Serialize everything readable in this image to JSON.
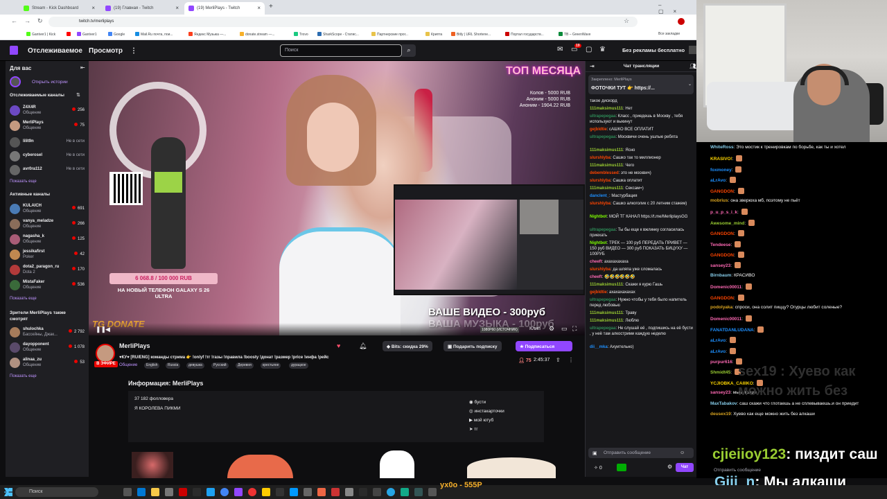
{
  "browser": {
    "tabs": [
      {
        "title": "Stream - Kick Dashboard",
        "color": "#53fc18"
      },
      {
        "title": "(19) Главная - Twitch",
        "color": "#9147ff"
      },
      {
        "title": "(19) MerliPlays - Twitch",
        "color": "#9147ff"
      }
    ],
    "url": "twitch.tv/merliplays",
    "bookmarks": [
      "Gantver1 | Kick",
      "Gantver1",
      "Google",
      "Mail.Ru почта, пои...",
      "Яндекс Музыка —...",
      "donate.stream —...",
      "Trovo",
      "SharkScope - Статис...",
      "Партнерские прог...",
      "Крипта",
      "Bitly | URL Shortene...",
      "Портал государств...",
      "TB – GreenWave",
      "Все закладки"
    ]
  },
  "twitch_nav": {
    "following": "Отслеживаемое",
    "browse": "Просмотр",
    "search_placeholder": "Поиск",
    "badge_count": "19",
    "prime": "Без рекламы бесплатно"
  },
  "sidebar": {
    "for_you": "Для вас",
    "open_history": "Открыть истории",
    "followed_header": "Отслеживаемые каналы",
    "followed": [
      {
        "name": "Z4X4R",
        "game": "Общение",
        "viewers": "256",
        "color": "#6c49c4"
      },
      {
        "name": "MerliPlays",
        "game": "Общение",
        "viewers": "75",
        "color": "#c59a80"
      },
      {
        "name": "lilit9n",
        "game": "",
        "viewers": "Не в сети",
        "color": "#555"
      },
      {
        "name": "cyberosel",
        "game": "",
        "viewers": "Не в сети",
        "color": "#777"
      },
      {
        "name": "avr0ra112",
        "game": "",
        "viewers": "Не в сети",
        "color": "#666"
      }
    ],
    "show_more": "Показать еще",
    "active_header": "Активные каналы",
    "active": [
      {
        "name": "KULAICH",
        "game": "Общение",
        "viewers": "691",
        "color": "#4a7bb5"
      },
      {
        "name": "vanya_meladze",
        "game": "Общение",
        "viewers": "266",
        "color": "#8a6d5a"
      },
      {
        "name": "nagasha_k",
        "game": "Общение",
        "viewers": "125",
        "color": "#a85c77"
      },
      {
        "name": "jessikafirst",
        "game": "Poker",
        "viewers": "42",
        "color": "#c08850"
      },
      {
        "name": "dota2_paragon_ru",
        "game": "Dota 2",
        "viewers": "170",
        "color": "#b23a3a"
      },
      {
        "name": "MistaFaker",
        "game": "Общение",
        "viewers": "536",
        "color": "#3a6a3a"
      }
    ],
    "show_more2": "Показать еще",
    "viewers_also_header": "Зрители MerliPlays также смотрят",
    "viewers_also": [
      {
        "name": "shulochka",
        "game": "Бассейны, Джак...",
        "viewers": "2 792",
        "color": "#a67b5b"
      },
      {
        "name": "dayopponent",
        "game": "Общение",
        "viewers": "1 078",
        "color": "#5a4a6a"
      },
      {
        "name": "alinaa_zu",
        "game": "Общение",
        "viewers": "53",
        "color": "#b09080"
      }
    ],
    "show_more3": "Показать еще"
  },
  "video": {
    "top_month": "ТОП МЕСЯЦА",
    "top_lines": [
      "Колов - 5000 RUB",
      "Аноним - 5000 RUB",
      "Аноним - 1904.22 RUB"
    ],
    "donate_progress": "6 068.8 / 100 000 RUB",
    "donate_goal": "НА НОВЫЙ ТЕЛЕФОН GALAXY S 26 ULTRA",
    "overlay_text": "ВАШЕ ВИДЕО - 300руб",
    "overlay_text2": "ВАША МУЗЫКА - 100руб",
    "tg_donate": "TG DONATE",
    "quality": "1080P60 (ИСТОЧНИК)",
    "clip": "Клип"
  },
  "stream_info": {
    "streamer": "MerliPlays",
    "live": "В ЭФИРЕ",
    "title": "♥КУ♥ [RU/ENG] команды стрима 👉 !onlyf !тг !газы !правила !boosty !донат !размер !price !инфа !рейс",
    "game": "Общение",
    "tags": [
      "English",
      "Russia",
      "девушка",
      "Русский",
      "Деревня",
      "крестьяне",
      "дурацкое"
    ],
    "bits_btn": "Bits: скидка 29%",
    "gift_btn": "Подарить подписку",
    "sub_btn": "Подписаться",
    "viewers": "75",
    "uptime": "2:45:37",
    "about_header": "Информация: MerliPlays",
    "followers": "37 182 фолловера",
    "bio": "Я КОРОЛЕВА ПИКМИ",
    "socials": [
      "бусти",
      "инстакарточки",
      "мой ютуб",
      "тг"
    ]
  },
  "chat": {
    "header": "Чат трансляции",
    "pinned_by": "Закреплено: MerliPlays",
    "pinned_text": "ФОТОЧКИ ТУТ 👉 https://...",
    "messages": [
      {
        "user": "",
        "color": "#efeff1",
        "text": "такое дискорд"
      },
      {
        "user": "111maksimus111",
        "color": "#9acd32",
        "text": "Нет"
      },
      {
        "user": "ultrapepegaa",
        "color": "#2e8b57",
        "text": "Класс , приедешь в Москву , тебя используют и выкинут"
      },
      {
        "user": "gejbldtie",
        "color": "#ff4500",
        "text": "сАШКО ВСЕ ОПЛАТИТ"
      },
      {
        "user": "ultrapepegaa",
        "color": "#2e8b57",
        "text": "Москвичи очень ушлые ребята"
      },
      {
        "user": "111maksimus111",
        "color": "#9acd32",
        "text": "Ясно"
      },
      {
        "user": "slurshlyba",
        "color": "#ff4500",
        "text": "Сашко так то миллионер"
      },
      {
        "user": "111maksimus111",
        "color": "#9acd32",
        "text": "Чего"
      },
      {
        "user": "debemblessed",
        "color": "#ff4500",
        "text": "это не москвич)"
      },
      {
        "user": "slurshlyba",
        "color": "#ff4500",
        "text": "Сашка оплатит"
      },
      {
        "user": "111maksimus111",
        "color": "#9acd32",
        "text": "Сексам=)"
      },
      {
        "user": "danclent_",
        "color": "#1e90ff",
        "text": "Мастурбация"
      },
      {
        "user": "slurshlyba",
        "color": "#ff4500",
        "text": "Сашко алкоголик с 20 летним стажем)"
      },
      {
        "user": "Nightbot",
        "color": "#7fff00",
        "text": "МОЙ ТГ КАНАЛ https://t.me/MerliplaysGG"
      },
      {
        "user": "ultrapepegaa",
        "color": "#2e8b57",
        "text": "Ты бы еще к вжлинку согласилась приехать"
      },
      {
        "user": "Nightbot",
        "color": "#7fff00",
        "text": "ТРЕК — 100 руб ПЕРЕДАТЬ ПРИВЕТ — 150 руб ВИДЕО — 300 руб ПОКАЗАТЬ БИЦУХУ — 100РУБ"
      },
      {
        "user": "cheeft",
        "color": "#ff69b4",
        "text": "ахахахахаха"
      },
      {
        "user": "slurshlyba",
        "color": "#ff4500",
        "text": "да шляпа уже сломалась"
      },
      {
        "user": "cheeft",
        "color": "#ff69b4",
        "text": "🤣🤣🤣🤣🤣🤣"
      },
      {
        "user": "111maksimus111",
        "color": "#9acd32",
        "text": "Скажи я курю Гашь"
      },
      {
        "user": "gejbldtie",
        "color": "#ff4500",
        "text": "ахахахахахах"
      },
      {
        "user": "ultrapepegaa",
        "color": "#2e8b57",
        "text": "Нужно чтобы у тебя было напитель перед любовью"
      },
      {
        "user": "111maksimus111",
        "color": "#9acd32",
        "text": "Траву"
      },
      {
        "user": "111maksimus111",
        "color": "#9acd32",
        "text": "Люблю"
      },
      {
        "user": "ultrapepegaa",
        "color": "#2e8b57",
        "text": "Не слушай её , подпишись на её бусти , у неё там алкострими каждую неделю"
      },
      {
        "user": "dii__mka",
        "color": "#1e90ff",
        "text": "Ахуительно)"
      }
    ],
    "input_placeholder": "Отправить сообщение",
    "points": "0",
    "send": "Чат"
  },
  "overlay_chat": {
    "messages": [
      {
        "user": "WhiteRoss",
        "color": "#87ceeb",
        "text": "Это мостик к тренировкам по борьбе, как ты и хотел"
      },
      {
        "user": "KRASIVO!",
        "color": "#ffd700",
        "text": ""
      },
      {
        "user": "foxmoney",
        "color": "#1e90ff",
        "text": ""
      },
      {
        "user": "aLrAvo",
        "color": "#1e90ff",
        "text": ""
      },
      {
        "user": "GANGDON",
        "color": "#ff4500",
        "text": ""
      },
      {
        "user": "mobrius",
        "color": "#daa520",
        "text": "она зверюха мб, поэтому не пьёт"
      },
      {
        "user": "p_u_p_s_i_k",
        "color": "#ff69b4",
        "text": ""
      },
      {
        "user": "Awesome_mind",
        "color": "#9acd32",
        "text": ""
      },
      {
        "user": "GANGDON",
        "color": "#ff4500",
        "text": ""
      },
      {
        "user": "Tendeese",
        "color": "#ff69b4",
        "text": ""
      },
      {
        "user": "GANGDON",
        "color": "#ff4500",
        "text": ""
      },
      {
        "user": "sansey23",
        "color": "#ff69b4",
        "text": ""
      },
      {
        "user": "Birnbaum",
        "color": "#87ceeb",
        "text": "КРАСИВО"
      },
      {
        "user": "Domenic00011",
        "color": "#ff69b4",
        "text": ""
      },
      {
        "user": "GANGDON",
        "color": "#ff4500",
        "text": ""
      },
      {
        "user": "podolyaka",
        "color": "#daa520",
        "text": "спроси, она солит пиццу? Огурцы любит соленые?"
      },
      {
        "user": "Domenic00011",
        "color": "#ff69b4",
        "text": ""
      },
      {
        "user": "FANATDANLUDANA",
        "color": "#1e90ff",
        "text": ""
      },
      {
        "user": "aLrAvo",
        "color": "#1e90ff",
        "text": ""
      },
      {
        "user": "aLrAvo",
        "color": "#1e90ff",
        "text": ""
      },
      {
        "user": "purpur616",
        "color": "#ff69b4",
        "text": ""
      },
      {
        "user": "Shmidt45",
        "color": "#9acd32",
        "text": ""
      },
      {
        "user": "YCJIOBKA_CAIIIKO",
        "color": "#ffd700",
        "text": ""
      },
      {
        "user": "sansey23",
        "color": "#ff69b4",
        "text": "мы алкаши"
      },
      {
        "user": "MaxTabakov",
        "color": "#87ceeb",
        "text": "саш скажи что глотаешь а не сплевываешь.и он приедит"
      },
      {
        "user": "deusex19",
        "color": "#daa520",
        "text": "Хуево как еще можно жить без алкаши"
      },
      {
        "user": "cjieiioy123",
        "color": "#9acd32",
        "text": "пиздит саш"
      },
      {
        "user": "Giii_n",
        "color": "#87ceeb",
        "text": "Мы алкаши..."
      }
    ],
    "big_user1": "cjieiioy123",
    "big_text1": ": пиздит саш",
    "big_user2": "Giii_n",
    "big_text2": ": Мы алкаши",
    "ghost1": "sex19 : Хуево как",
    "ghost2": "можно жить без",
    "input": "Отправить сообщение"
  },
  "taskbar": {
    "search": "Поиск",
    "donation_overlay": "ух0о - 555Р"
  }
}
